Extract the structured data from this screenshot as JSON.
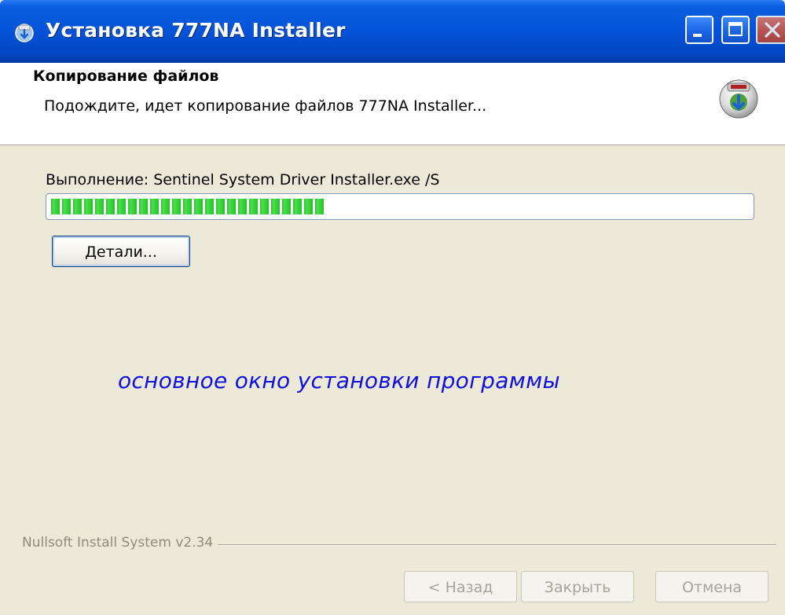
{
  "window": {
    "title": "Установка 777NA Installer",
    "icon": "installer-app-icon"
  },
  "header": {
    "title": "Копирование файлов",
    "subtitle": "Подождите, идет копирование файлов 777NA Installer...",
    "icon": "disk-install-icon"
  },
  "progress": {
    "status": "Выполнение: Sentinel System Driver Installer.exe /S",
    "value": 0.4
  },
  "buttons": {
    "details": "Детали...",
    "back": "< Назад",
    "close": "Закрыть",
    "cancel": "Отмена"
  },
  "annotation": "основное  окно установки программы",
  "branding": "Nullsoft Install System v2.34",
  "colors": {
    "titlebar": "#0553D8",
    "progress_fill": "#27C52A",
    "annotation": "#1010E0",
    "background": "#ECE9D8"
  }
}
